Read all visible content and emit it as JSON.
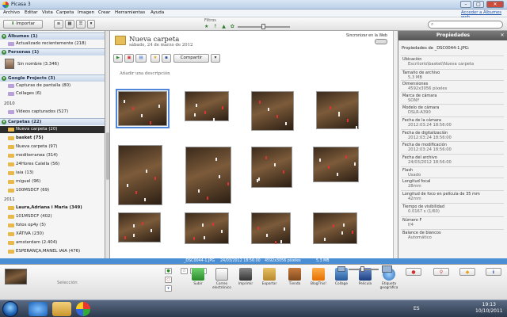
{
  "window": {
    "title": "Picasa 3",
    "buttons": {
      "minimize": "–",
      "maximize": "□",
      "close": "✕"
    }
  },
  "menu": {
    "items": [
      "Archivo",
      "Editar",
      "Vista",
      "Carpeta",
      "Imagen",
      "Crear",
      "Herramientas",
      "Ayuda"
    ],
    "signin": "Acceder a Álbumes web"
  },
  "toolbar": {
    "import": "Importar",
    "filters_label": "Filtros",
    "filter_stars": "★ ↑ ▲ ✿"
  },
  "left_panel": {
    "sections": [
      {
        "label": "Álbumes (1)"
      },
      {
        "label": "Personas (1)"
      },
      {
        "label": "Google Projects (3)"
      },
      {
        "label": "Carpetas (22)"
      }
    ],
    "rows": [
      "Actualizado recientemente (218)",
      "Sin nombre (3.346)",
      "Capturas de pantalla (80)",
      "Collages (6)",
      "Vídeos capturados (527)",
      "Nueva carpeta (20)",
      "basket (75)",
      "Nueva carpeta (97)",
      "mediterranea (314)",
      "24Hores Calella (56)",
      "iaia (13)",
      "miguel (96)",
      "100MSDCF (69)",
      "Laura,Adriana i Maria (349)",
      "101MSDCF (402)",
      "fotos op4y (5)",
      "XÀTIVA (230)",
      "amsterdam (2.404)",
      "ESPERANÇA,MANEL IAIA (476)"
    ],
    "years": [
      "2010",
      "2011"
    ]
  },
  "main": {
    "folder_title": "Nueva carpeta",
    "folder_date": "sábado, 24 de marzo de 2012",
    "sync_label": "Sincronizar en la Web",
    "share_button": "Compartir",
    "add_description": "Añadir una descripción"
  },
  "properties": {
    "header": "Propiedades",
    "file_label": "Propiedades de _DSC0044-1.JPG:",
    "fields": [
      {
        "key": "Ubicación",
        "value": "Escritorio\\basket\\Nueva carpeta"
      },
      {
        "key": "Tamaño de archivo",
        "value": "5,3 MB"
      },
      {
        "key": "Dimensiones",
        "value": "4592x3056 píxeles"
      },
      {
        "key": "Marca de cámara",
        "value": "SONY"
      },
      {
        "key": "Modelo de cámara",
        "value": "DSLR-A390"
      },
      {
        "key": "Fecha de la cámara",
        "value": "2012:03:24 18:56:00"
      },
      {
        "key": "Fecha de digitalización",
        "value": "2012:03:24 18:56:00"
      },
      {
        "key": "Fecha de modificación",
        "value": "2012:03:24 18:56:00"
      },
      {
        "key": "Fecha del archivo",
        "value": "24/03/2012 18:56:00"
      },
      {
        "key": "Flash",
        "value": "Usado"
      },
      {
        "key": "Longitud focal",
        "value": "28mm"
      },
      {
        "key": "Longitud de foco en película de 35 mm",
        "value": "42mm"
      },
      {
        "key": "Tiempo de visibilidad",
        "value": "0.0167 s (1/60)"
      },
      {
        "key": "Número F",
        "value": "f/4"
      },
      {
        "key": "Balance de blancos",
        "value": "Automático"
      }
    ]
  },
  "statusbar": {
    "filename": "_DSC0044-1.JPG",
    "datetime": "24/03/2012 18:56:00",
    "dimensions": "4592x3056 píxeles",
    "size": "5,3 MB"
  },
  "tray": {
    "selection_label": "Selección",
    "actions": [
      "Subir",
      "Correo electrónico",
      "Imprimir",
      "Exportar",
      "Tienda",
      "BlogThis!",
      "Collage",
      "Película",
      "Etiqueta geográfica"
    ]
  },
  "taskbar": {
    "lang": "ES",
    "time": "19:13",
    "date": "10/10/2011"
  },
  "colors": {
    "accent": "#4a8fd4",
    "selected_row": "#2d2d2d",
    "section_header": "#c7d6ea"
  }
}
